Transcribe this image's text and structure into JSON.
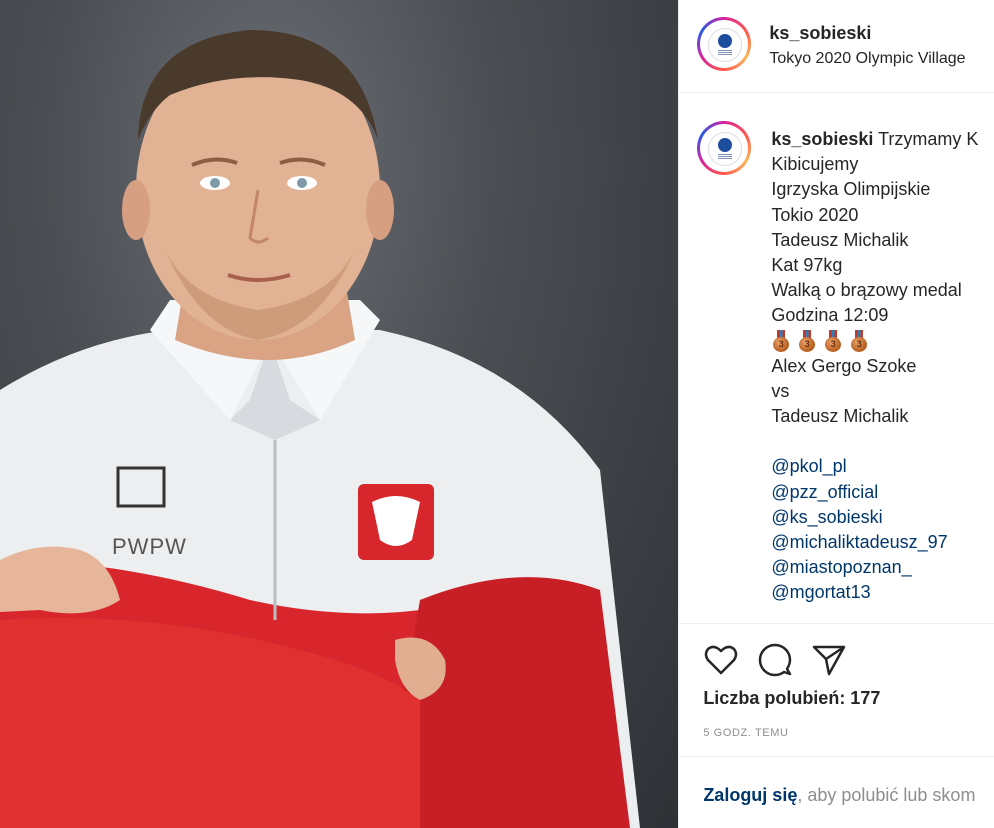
{
  "post": {
    "username": "ks_sobieski",
    "location": "Tokyo 2020 Olympic Village",
    "avatar_label": "KS Sobieski Poznań logo",
    "photo_alt": "Wrestler in white and red Poland team jacket with arms crossed",
    "jacket_brand": "PWPW",
    "caption": {
      "author": "ks_sobieski",
      "first_line": "Trzymamy K",
      "lines": [
        "Kibicujemy",
        "Igrzyska Olimpijskie",
        "Tokio 2020",
        "Tadeusz Michalik",
        "Kat 97kg",
        "Walką o brązowy medal",
        "Godzina 12:09"
      ],
      "medal_count": 4,
      "lines_after": [
        "Alex Gergo Szoke",
        "vs",
        "Tadeusz Michalik"
      ],
      "mentions": [
        "@pkol_pl",
        "@pzz_official",
        "@ks_sobieski",
        "@michaliktadeusz_97",
        "@miastopoznan_",
        "@mgortat13"
      ]
    },
    "likes_text": "Liczba polubień: 177",
    "time_text": "5 GODZ. TEMU",
    "login": {
      "link": "Zaloguj się",
      "rest": ", aby polubić lub skom"
    },
    "icons": [
      "heart-icon",
      "comment-icon",
      "share-icon"
    ]
  }
}
